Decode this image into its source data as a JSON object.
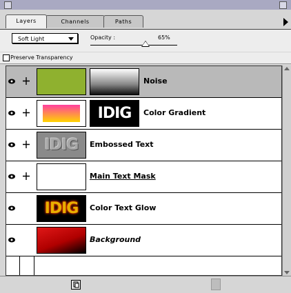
{
  "tabs": [
    "Layers",
    "Channels",
    "Paths"
  ],
  "blend_mode": "Soft Light",
  "opacity": {
    "label": "Opacity :",
    "value": "65%"
  },
  "preserve_transparency": {
    "label": "Preserve Transparency",
    "checked": false
  },
  "layers": [
    {
      "name": "Noise",
      "selected": true,
      "italic": false,
      "underline": false,
      "has_mask": true,
      "has_link": true
    },
    {
      "name": "Color Gradient",
      "selected": false,
      "italic": false,
      "underline": false,
      "has_mask": true,
      "has_link": true
    },
    {
      "name": "Embossed Text",
      "selected": false,
      "italic": false,
      "underline": false,
      "has_mask": false,
      "has_link": true
    },
    {
      "name": "Main Text Mask",
      "selected": false,
      "italic": false,
      "underline": true,
      "has_mask": false,
      "has_link": true
    },
    {
      "name": "Color Text Glow",
      "selected": false,
      "italic": false,
      "underline": false,
      "has_mask": false,
      "has_link": false
    },
    {
      "name": "Background",
      "selected": false,
      "italic": true,
      "underline": false,
      "has_mask": false,
      "has_link": false
    }
  ],
  "thumbnail_text": "IDIG",
  "colors": {
    "noise": "#8fb12f",
    "gradient_top": "#ff3fa0",
    "gradient_bottom": "#ffd400",
    "glow": "#e8b000",
    "bg_red": "#d11010"
  }
}
